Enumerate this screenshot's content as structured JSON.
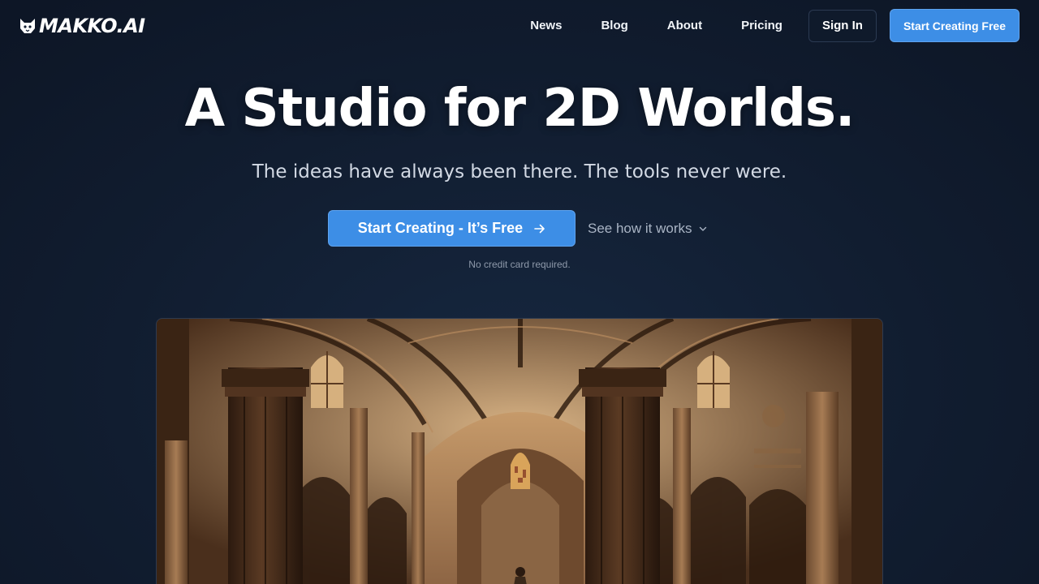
{
  "brand": {
    "name": "MAKKO.AI",
    "logo_icon": "cat-head-icon"
  },
  "nav": {
    "links": [
      {
        "label": "News"
      },
      {
        "label": "Blog"
      },
      {
        "label": "About"
      },
      {
        "label": "Pricing"
      }
    ],
    "sign_in_label": "Sign In",
    "start_label": "Start Creating Free"
  },
  "hero": {
    "title": "A Studio for 2D Worlds.",
    "subtitle": "The ideas have always been there. The tools never were.",
    "cta_label": "Start Creating - It’s Free",
    "cta_icon": "arrow-right-icon",
    "secondary_label": "See how it works",
    "secondary_icon": "chevron-down-icon",
    "note": "No credit card required."
  },
  "showcase": {
    "image": "gothic-cathedral-interior-illustration"
  },
  "colors": {
    "background": "#111d30",
    "accent": "#3d8ee6",
    "text": "#ffffff",
    "muted": "#a9b4c4"
  }
}
